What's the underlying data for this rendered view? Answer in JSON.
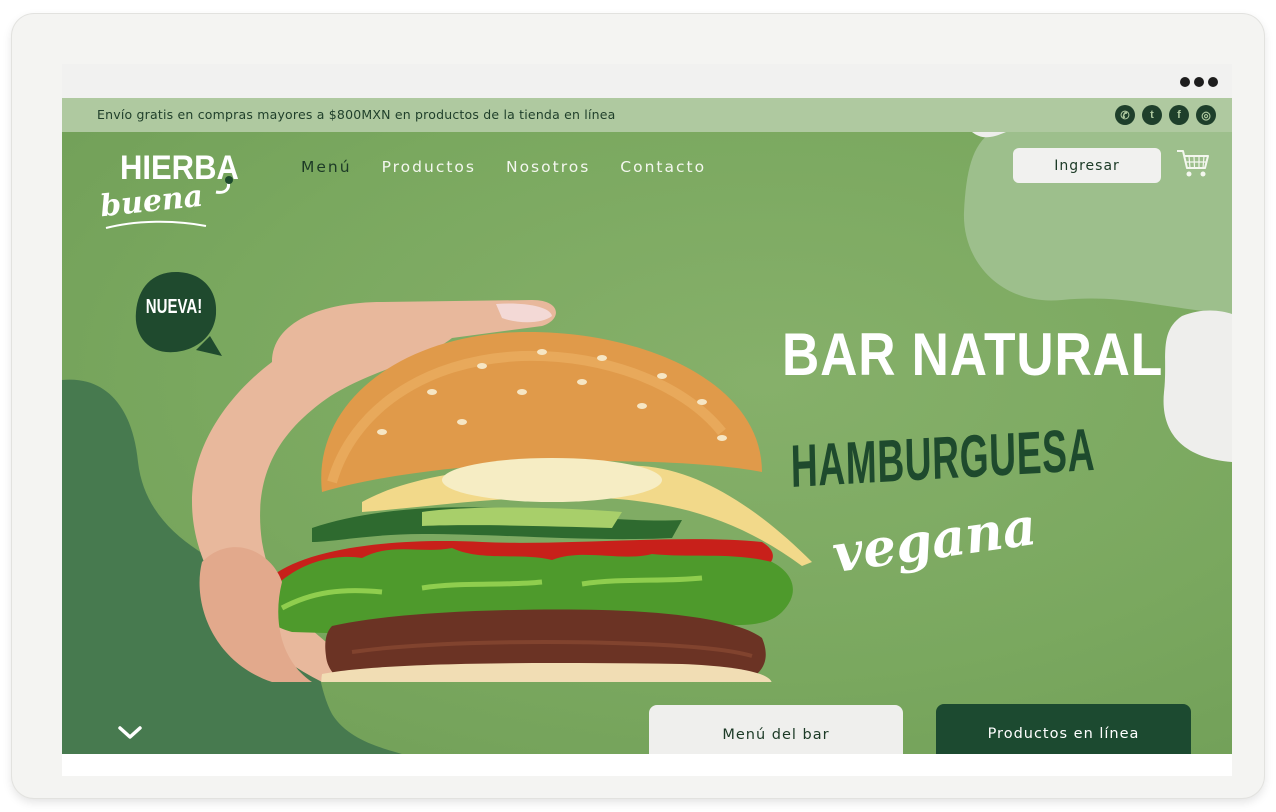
{
  "announcement": "Envío gratis en compras mayores a $800MXN en productos de la tienda en línea",
  "socials": [
    {
      "icon": "whatsapp-icon",
      "glyph": "✆"
    },
    {
      "icon": "twitter-icon",
      "glyph": "t"
    },
    {
      "icon": "facebook-icon",
      "glyph": "f"
    },
    {
      "icon": "instagram-icon",
      "glyph": "◎"
    }
  ],
  "logo": {
    "top": "HIERBA",
    "bottom": "buena"
  },
  "nav": {
    "items": [
      "Menú",
      "Productos",
      "Nosotros",
      "Contacto"
    ],
    "active": "Menú"
  },
  "header": {
    "login_label": "Ingresar",
    "cart_icon": "cart-icon"
  },
  "badge": "NUEVA!",
  "hero": {
    "title": "BAR NATURAL",
    "subtitle": "HAMBURGUESA",
    "script": "vegana"
  },
  "buttons": {
    "menu": "Menú del bar",
    "products": "Productos en línea"
  },
  "colors": {
    "hero_green": "#7aa85f",
    "dark_green": "#1c4a30",
    "announce_bar": "#afc9a0",
    "light_blob": "#9dbf8c"
  }
}
